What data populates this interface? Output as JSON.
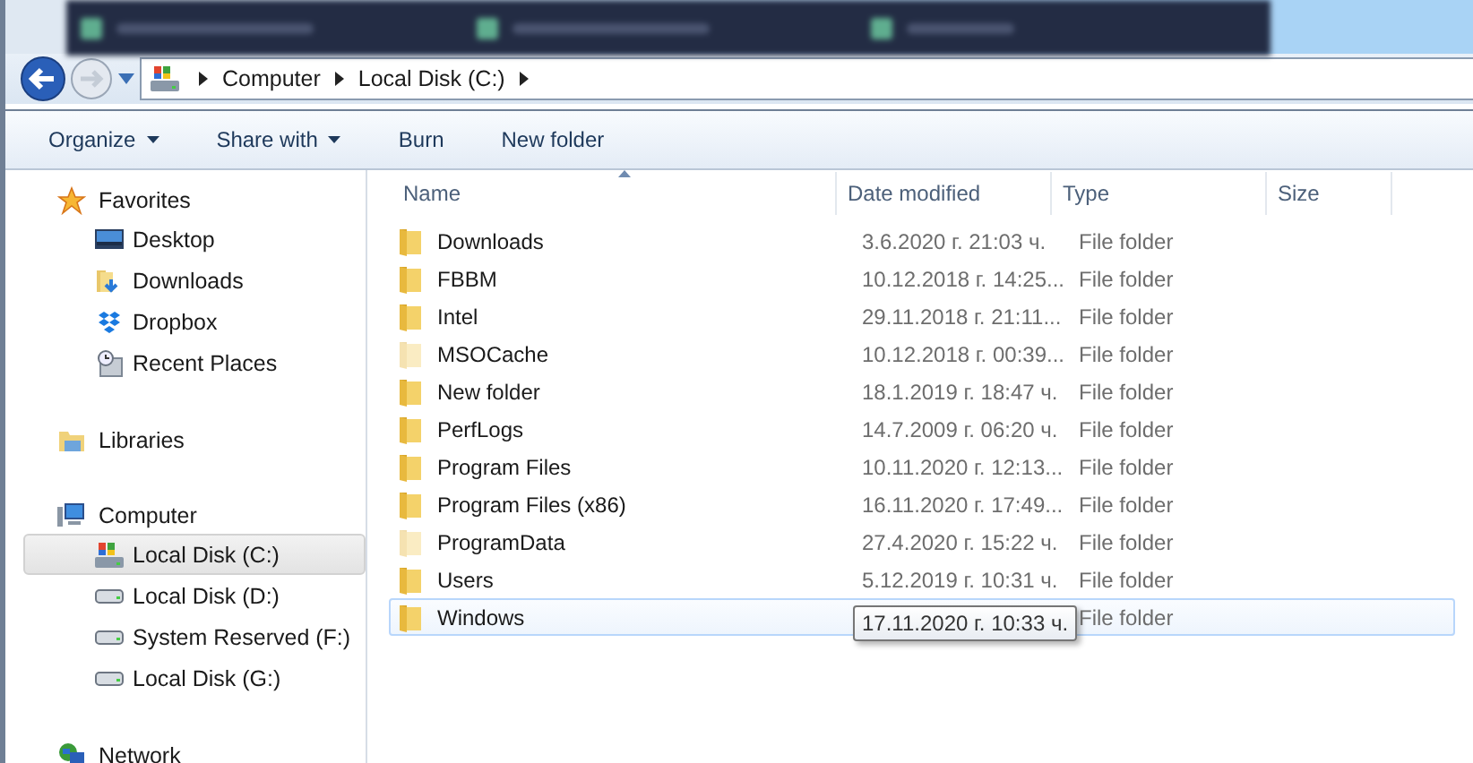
{
  "address_bar": {
    "crumbs": [
      "Computer",
      "Local Disk (C:)"
    ]
  },
  "toolbar": [
    {
      "label": "Organize",
      "dropdown": true
    },
    {
      "label": "Share with",
      "dropdown": true
    },
    {
      "label": "Burn",
      "dropdown": false
    },
    {
      "label": "New folder",
      "dropdown": false
    }
  ],
  "sidebar": {
    "groups": [
      {
        "label": "Favorites",
        "kind": "star",
        "items": [
          {
            "label": "Desktop",
            "kind": "desktop",
            "selected": false
          },
          {
            "label": "Downloads",
            "kind": "downloads",
            "selected": false
          },
          {
            "label": "Dropbox",
            "kind": "dropbox",
            "selected": false
          },
          {
            "label": "Recent Places",
            "kind": "recent",
            "selected": false
          }
        ]
      },
      {
        "label": "Libraries",
        "kind": "libraries"
      },
      {
        "label": "Computer",
        "kind": "computer",
        "items": [
          {
            "label": "Local Disk (C:)",
            "kind": "system",
            "selected": true
          },
          {
            "label": "Local Disk (D:)",
            "kind": "disk",
            "selected": false
          },
          {
            "label": "System Reserved (F:)",
            "kind": "disk",
            "selected": false
          },
          {
            "label": "Local Disk (G:)",
            "kind": "disk",
            "selected": false
          }
        ]
      },
      {
        "label": "Network",
        "kind": "network"
      }
    ]
  },
  "table": {
    "columns": [
      "Name",
      "Date modified",
      "Type",
      "Size"
    ],
    "rows": [
      {
        "name": "Downloads",
        "date": "3.6.2020 г. 21:03 ч.",
        "type": "File folder",
        "hidden": false,
        "selected": false,
        "tooltip": false
      },
      {
        "name": "FBBM",
        "date": "10.12.2018 г. 14:25...",
        "type": "File folder",
        "hidden": false,
        "selected": false,
        "tooltip": false
      },
      {
        "name": "Intel",
        "date": "29.11.2018 г. 21:11...",
        "type": "File folder",
        "hidden": false,
        "selected": false,
        "tooltip": false
      },
      {
        "name": "MSOCache",
        "date": "10.12.2018 г. 00:39...",
        "type": "File folder",
        "hidden": true,
        "selected": false,
        "tooltip": false
      },
      {
        "name": "New folder",
        "date": "18.1.2019 г. 18:47 ч.",
        "type": "File folder",
        "hidden": false,
        "selected": false,
        "tooltip": false
      },
      {
        "name": "PerfLogs",
        "date": "14.7.2009 г. 06:20 ч.",
        "type": "File folder",
        "hidden": false,
        "selected": false,
        "tooltip": false
      },
      {
        "name": "Program Files",
        "date": "10.11.2020 г. 12:13...",
        "type": "File folder",
        "hidden": false,
        "selected": false,
        "tooltip": false
      },
      {
        "name": "Program Files (x86)",
        "date": "16.11.2020 г. 17:49...",
        "type": "File folder",
        "hidden": false,
        "selected": false,
        "tooltip": false
      },
      {
        "name": "ProgramData",
        "date": "27.4.2020 г. 15:22 ч.",
        "type": "File folder",
        "hidden": true,
        "selected": false,
        "tooltip": false
      },
      {
        "name": "Users",
        "date": "5.12.2019 г. 10:31 ч.",
        "type": "File folder",
        "hidden": false,
        "selected": false,
        "tooltip": false
      },
      {
        "name": "Windows",
        "date": "17.11.2020 г. 10:33 ч.",
        "type": "File folder",
        "hidden": false,
        "selected": true,
        "tooltip": true
      }
    ]
  }
}
